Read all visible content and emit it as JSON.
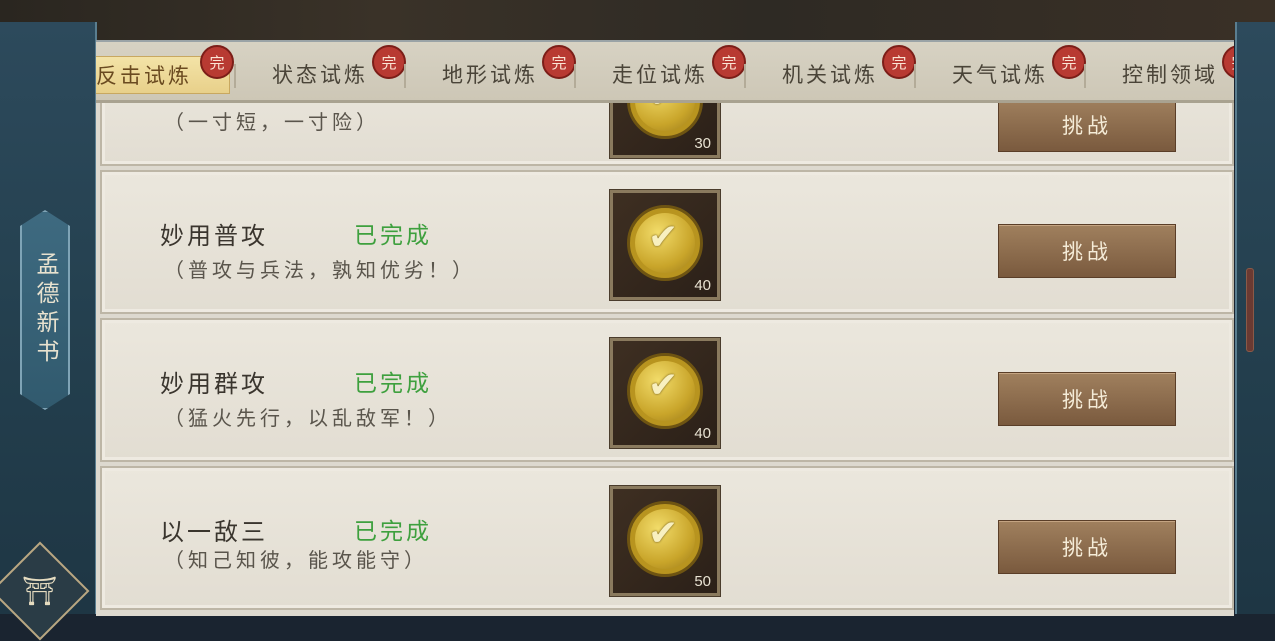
{
  "side_tag": "孟德新书",
  "bottom_icon": "scroll-chest-icon",
  "tabs": [
    {
      "label": "反击试炼",
      "active": true,
      "badge": "完"
    },
    {
      "label": "状态试炼",
      "active": false,
      "badge": "完"
    },
    {
      "label": "地形试炼",
      "active": false,
      "badge": "完"
    },
    {
      "label": "走位试炼",
      "active": false,
      "badge": "完"
    },
    {
      "label": "机关试炼",
      "active": false,
      "badge": "完"
    },
    {
      "label": "天气试炼",
      "active": false,
      "badge": "完"
    },
    {
      "label": "控制领域",
      "active": false,
      "badge": "完"
    }
  ],
  "trials": [
    {
      "title": "",
      "status": "",
      "desc": "（一寸短，一寸险）",
      "reward_count": "30",
      "button": "挑战"
    },
    {
      "title": "妙用普攻",
      "status": "已完成",
      "desc": "（普攻与兵法，孰知优劣！）",
      "reward_count": "40",
      "button": "挑战"
    },
    {
      "title": "妙用群攻",
      "status": "已完成",
      "desc": "（猛火先行，以乱敌军！）",
      "reward_count": "40",
      "button": "挑战"
    },
    {
      "title": "以一敌三",
      "status": "已完成",
      "desc": "（知己知彼，能攻能守）",
      "reward_count": "50",
      "button": "挑战"
    }
  ],
  "colors": {
    "completed": "#3ea03e",
    "badge": "#b83a32",
    "active_tab": "#e8d08a"
  }
}
